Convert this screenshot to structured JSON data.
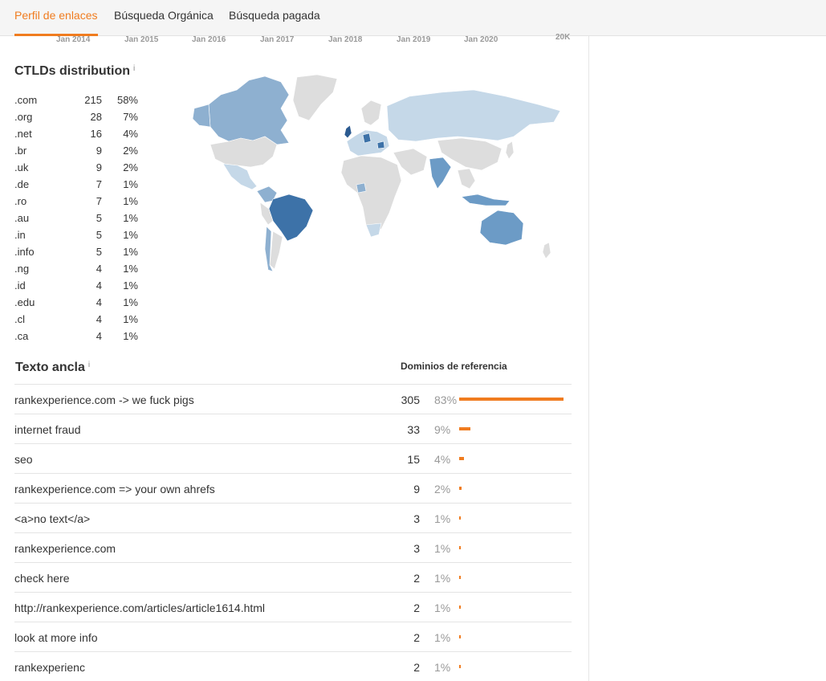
{
  "tabs": [
    {
      "label": "Perfil de enlaces",
      "active": true
    },
    {
      "label": "Búsqueda Orgánica",
      "active": false
    },
    {
      "label": "Búsqueda pagada",
      "active": false
    }
  ],
  "timeline": {
    "x_labels": [
      "Jan 2014",
      "Jan 2015",
      "Jan 2016",
      "Jan 2017",
      "Jan 2018",
      "Jan 2019",
      "Jan 2020"
    ],
    "y_label": "20K"
  },
  "ctlds": {
    "title": "CTLDs distribution",
    "info": "i",
    "rows": [
      {
        "tld": ".com",
        "count": "215",
        "pct": "58%"
      },
      {
        "tld": ".org",
        "count": "28",
        "pct": "7%"
      },
      {
        "tld": ".net",
        "count": "16",
        "pct": "4%"
      },
      {
        "tld": ".br",
        "count": "9",
        "pct": "2%"
      },
      {
        "tld": ".uk",
        "count": "9",
        "pct": "2%"
      },
      {
        "tld": ".de",
        "count": "7",
        "pct": "1%"
      },
      {
        "tld": ".ro",
        "count": "7",
        "pct": "1%"
      },
      {
        "tld": ".au",
        "count": "5",
        "pct": "1%"
      },
      {
        "tld": ".in",
        "count": "5",
        "pct": "1%"
      },
      {
        "tld": ".info",
        "count": "5",
        "pct": "1%"
      },
      {
        "tld": ".ng",
        "count": "4",
        "pct": "1%"
      },
      {
        "tld": ".id",
        "count": "4",
        "pct": "1%"
      },
      {
        "tld": ".edu",
        "count": "4",
        "pct": "1%"
      },
      {
        "tld": ".cl",
        "count": "4",
        "pct": "1%"
      },
      {
        "tld": ".ca",
        "count": "4",
        "pct": "1%"
      }
    ]
  },
  "map": {
    "colors": {
      "none": "#dddddd",
      "low": "#c5d8e8",
      "mid": "#8eb0d0",
      "high": "#6c9bc6",
      "top": "#3d72a8",
      "darkest": "#2b5a90"
    }
  },
  "anchors": {
    "title": "Texto ancla",
    "info": "i",
    "column_header": "Dominios de referencia",
    "accent": "#f07c1f",
    "rows": [
      {
        "text": "rankexperience.com -> we fuck pigs",
        "count": "305",
        "pct": "83%",
        "share": 83
      },
      {
        "text": "internet fraud",
        "count": "33",
        "pct": "9%",
        "share": 9
      },
      {
        "text": "seo",
        "count": "15",
        "pct": "4%",
        "share": 4
      },
      {
        "text": "rankexperience.com => your own ahrefs",
        "count": "9",
        "pct": "2%",
        "share": 2
      },
      {
        "text": "<a>no text</a>",
        "count": "3",
        "pct": "1%",
        "share": 1
      },
      {
        "text": "rankexperience.com",
        "count": "3",
        "pct": "1%",
        "share": 1
      },
      {
        "text": "check here",
        "count": "2",
        "pct": "1%",
        "share": 1
      },
      {
        "text": "http://rankexperience.com/articles/article1614.html",
        "count": "2",
        "pct": "1%",
        "share": 1
      },
      {
        "text": "look at more info",
        "count": "2",
        "pct": "1%",
        "share": 1
      },
      {
        "text": "rankexperienc",
        "count": "2",
        "pct": "1%",
        "share": 1
      }
    ]
  }
}
